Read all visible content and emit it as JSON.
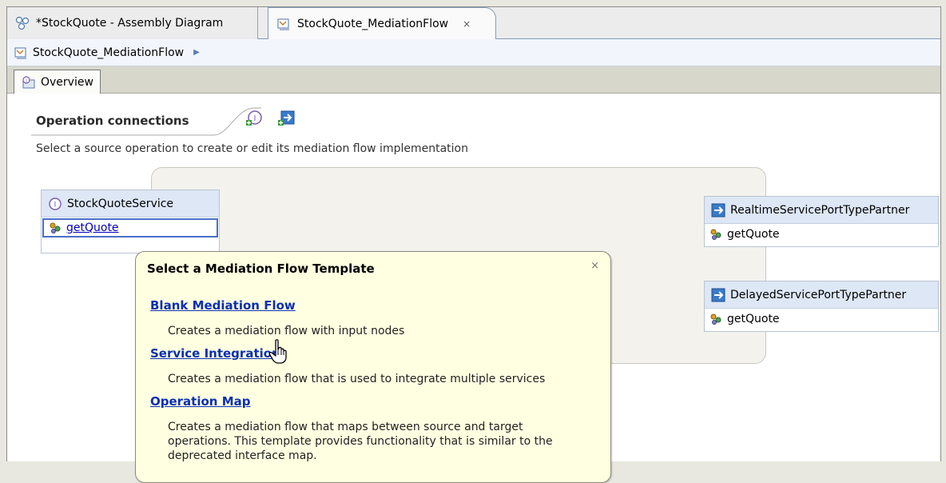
{
  "tabs": [
    {
      "label": "*StockQuote - Assembly Diagram",
      "icon": "assembly-diagram-icon",
      "active": false
    },
    {
      "label": "StockQuote_MediationFlow",
      "icon": "mediation-flow-icon",
      "active": true,
      "close": "×"
    }
  ],
  "breadcrumb": {
    "label": "StockQuote_MediationFlow",
    "arrow": "▶"
  },
  "page_tab": {
    "label": "Overview"
  },
  "section": {
    "title": "Operation connections",
    "description": "Select a source operation to create or edit its mediation flow implementation"
  },
  "source": {
    "name": "StockQuoteService",
    "operation": "getQuote"
  },
  "targets": [
    {
      "name": "RealtimeServicePortTypePartner",
      "operation": "getQuote"
    },
    {
      "name": "DelayedServicePortTypePartner",
      "operation": "getQuote"
    }
  ],
  "popup": {
    "title": "Select a Mediation Flow Template",
    "close": "×",
    "templates": [
      {
        "name": "Blank Mediation Flow",
        "description": [
          "Creates a mediation flow with input nodes"
        ]
      },
      {
        "name": "Service Integration",
        "description": [
          "Creates a mediation flow that is used to integrate multiple services"
        ]
      },
      {
        "name": "Operation Map",
        "description": [
          "Creates a mediation flow that maps between source and target",
          "operations. This template provides functionality that is similar to the",
          "deprecated interface map."
        ]
      }
    ]
  },
  "colors": {
    "link": "#0a2fb4",
    "popup_bg": "#ffffe1",
    "iface_head": "#dde7f5"
  }
}
